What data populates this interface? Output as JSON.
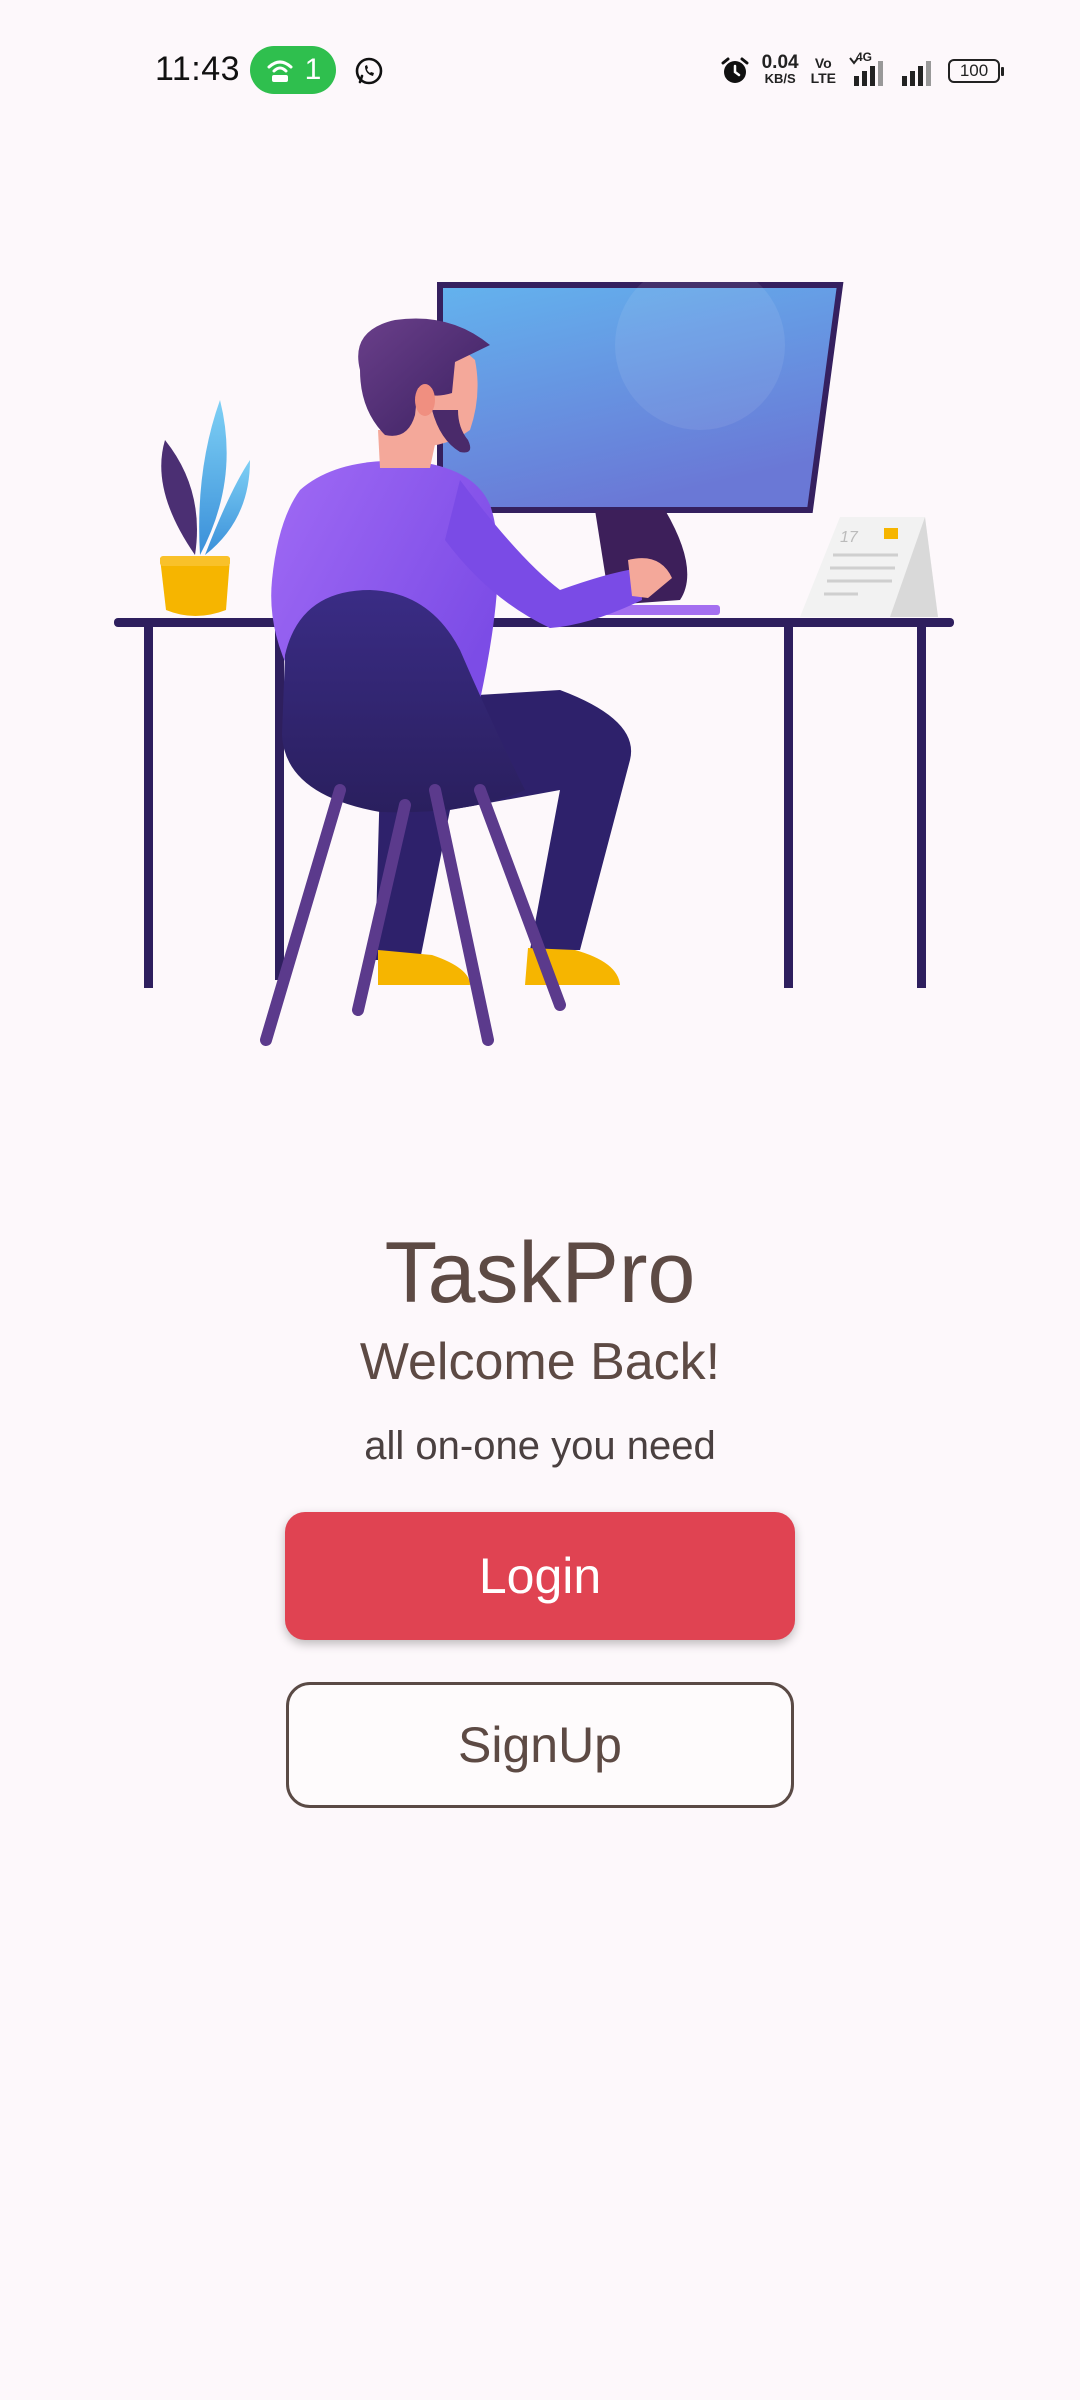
{
  "status_bar": {
    "time": "11:43",
    "hotspot_count": "1",
    "net_speed_value": "0.04",
    "net_speed_unit": "KB/S",
    "volte_top": "Vo",
    "volte_bottom": "LTE",
    "network_type": "4G",
    "battery": "100",
    "icons": [
      "hotspot-icon",
      "whatsapp-icon",
      "alarm-icon",
      "signal-icon",
      "battery-icon"
    ]
  },
  "illustration": {
    "calendar_day": "17",
    "colors": {
      "desk": "#2e1f5e",
      "monitor_screen": "#5fa8ec",
      "shirt": "#8a5cf0",
      "pot": "#f6b500",
      "chair": "#2d2570"
    }
  },
  "welcome": {
    "app_name": "TaskPro",
    "heading": "Welcome Back!",
    "tagline": "all on-one you need"
  },
  "actions": {
    "login_label": "Login",
    "signup_label": "SignUp"
  },
  "colors": {
    "background": "#fdf8fb",
    "primary": "#e04352",
    "text": "#5d4a44",
    "hotspot_badge": "#2fbf4e"
  }
}
